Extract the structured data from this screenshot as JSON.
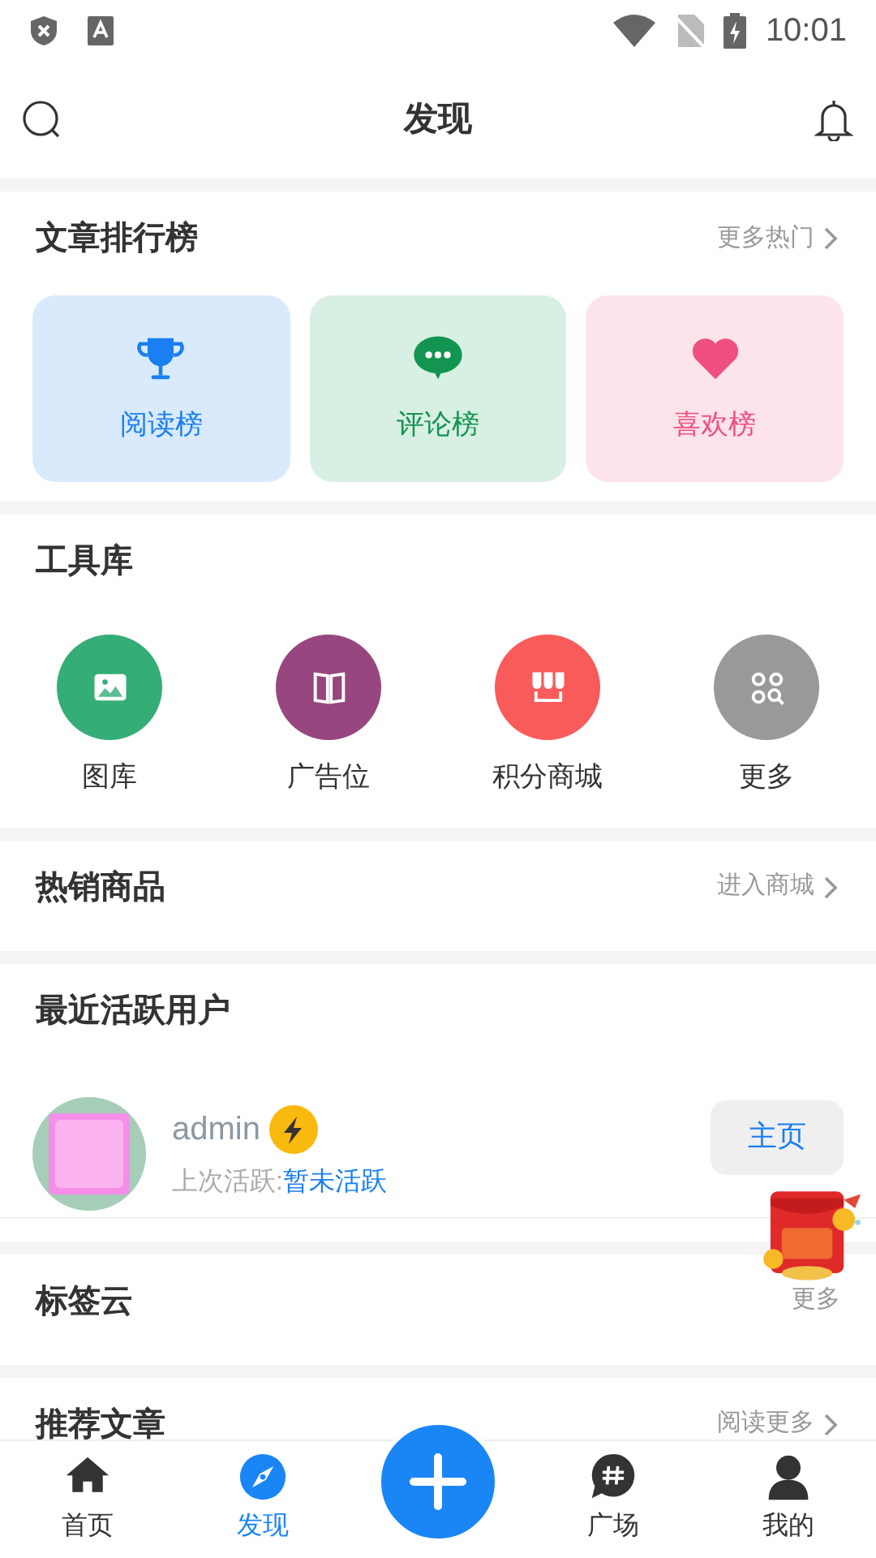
{
  "status_bar": {
    "time": "10:01"
  },
  "header": {
    "title": "发现"
  },
  "ranking": {
    "title": "文章排行榜",
    "more": "更多热门",
    "cards": [
      {
        "kind": "trophy",
        "label": "阅读榜"
      },
      {
        "kind": "comment",
        "label": "评论榜"
      },
      {
        "kind": "heart",
        "label": "喜欢榜"
      }
    ]
  },
  "tools": {
    "title": "工具库",
    "items": [
      {
        "label": "图库",
        "color": "#35ad77"
      },
      {
        "kind": "book",
        "label": "广告位",
        "color": "#97467f"
      },
      {
        "kind": "shop",
        "label": "积分商城",
        "color": "#f95b5b"
      },
      {
        "kind": "more",
        "label": "更多",
        "color": "#999999"
      }
    ]
  },
  "hot": {
    "title": "热销商品",
    "more": "进入商城"
  },
  "active_users": {
    "title": "最近活跃用户",
    "users": [
      {
        "name": "admin",
        "last_label": "上次活跃:",
        "last_value": "暂未活跃",
        "button": "主页"
      }
    ]
  },
  "tags": {
    "title": "标签云",
    "more": "更多"
  },
  "recommended": {
    "title": "推荐文章",
    "more": "阅读更多"
  },
  "nav": [
    {
      "kind": "home",
      "label": "首页",
      "selected": false
    },
    {
      "kind": "discover",
      "label": "发现",
      "selected": true
    },
    {
      "kind": "add"
    },
    {
      "kind": "square",
      "label": "广场",
      "selected": false
    },
    {
      "kind": "me",
      "label": "我的",
      "selected": false
    }
  ]
}
